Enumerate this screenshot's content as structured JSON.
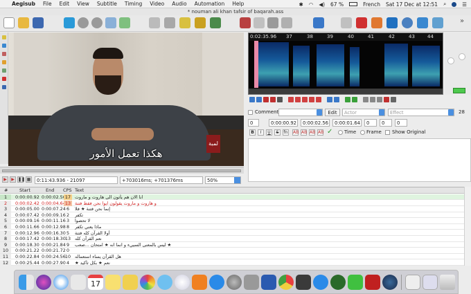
{
  "menubar": {
    "apple": "",
    "app_name": "Aegisub",
    "items": [
      "File",
      "Edit",
      "View",
      "Subtitle",
      "Timing",
      "Video",
      "Audio",
      "Automation",
      "Help"
    ],
    "battery": "67 %",
    "language": "French",
    "datetime": "Sat 17 Dec at 12:51"
  },
  "window": {
    "title": "* nouman ali khan tafsir of baqarah.ass"
  },
  "video": {
    "subtitle": "هكذا تعمل الأمور",
    "logo_text": "لمبة",
    "position": "0:11:43.936 - 21097",
    "offset": "+703016ms; +701376ms",
    "zoom": "50%"
  },
  "audio": {
    "ruler_start": "0:02:35.96",
    "ruler_ticks": [
      "37",
      "38",
      "39",
      "40",
      "41",
      "42",
      "43",
      "44",
      "45"
    ]
  },
  "edit": {
    "comment_label": "Comment",
    "edit_button": "Edit",
    "actor_placeholder": "Actor",
    "effect_placeholder": "Effect",
    "char_count": "28",
    "layer": "0",
    "start_time": "0:00:00.92",
    "end_time": "0:00:02.56",
    "duration": "0:00:01.64",
    "margin_l": "0",
    "margin_r": "0",
    "margin_v": "0",
    "time_label": "Time",
    "frame_label": "Frame",
    "show_original_label": "Show Original",
    "format_buttons": [
      "B",
      "I",
      "U",
      "S",
      "fn",
      "AB",
      "AB",
      "AB",
      "AB"
    ]
  },
  "grid": {
    "headers": [
      "#",
      "Start",
      "End",
      "CPS",
      "Text"
    ],
    "rows": [
      {
        "n": "1",
        "start": "0:00:00.92",
        "end": "0:00:02.56",
        "cps": "17",
        "text": "انا الان هم يأتون الى هاروت و ماروت"
      },
      {
        "n": "2",
        "start": "0:00:02.42",
        "end": "0:00:04.64",
        "cps": "13",
        "text": "و هاروت و ماروت يقولون ايوا نحن فقط فتنة"
      },
      {
        "n": "3",
        "start": "0:00:05.00",
        "end": "0:00:07.24",
        "cps": "6",
        "text": "إنما نحن فتنة ★ فلا"
      },
      {
        "n": "4",
        "start": "0:00:07.42",
        "end": "0:00:09.16",
        "cps": "2",
        "text": "تكفر"
      },
      {
        "n": "5",
        "start": "0:00:09.16",
        "end": "0:00:11.16",
        "cps": "3",
        "text": "لا تحصوا"
      },
      {
        "n": "6",
        "start": "0:00:11.66",
        "end": "0:00:12.98",
        "cps": "8",
        "text": "ماذا يعني تكفر"
      },
      {
        "n": "7",
        "start": "0:00:12.96",
        "end": "0:00:16.30",
        "cps": "5",
        "text": "أولا القرآن كله فتنة"
      },
      {
        "n": "8",
        "start": "0:00:17.42",
        "end": "0:00:18.30",
        "cps": "13",
        "text": "نعم القرآن كله"
      },
      {
        "n": "9",
        "start": "0:00:18.30",
        "end": "0:00:21.84",
        "cps": "9",
        "text": "ليس بالمعنى السييء و انما انه ★ امتحان ...صعب ★"
      },
      {
        "n": "10",
        "start": "0:00:21.22",
        "end": "0:00:21.72",
        "cps": "0",
        "text": ""
      },
      {
        "n": "11",
        "start": "0:00:22.84",
        "end": "0:00:24.56",
        "cps": "10",
        "text": "هل القرآن يساء استعماله"
      },
      {
        "n": "12",
        "start": "0:00:25.44",
        "end": "0:00:27.90",
        "cps": "4",
        "text": "★ نعم ★ بكل تأكيد"
      }
    ]
  },
  "colors": {
    "current_row": "#dff4df",
    "error_text": "#d02020",
    "audio_selection": "#e98aa8",
    "accent_blue": "#4a8fe0"
  }
}
